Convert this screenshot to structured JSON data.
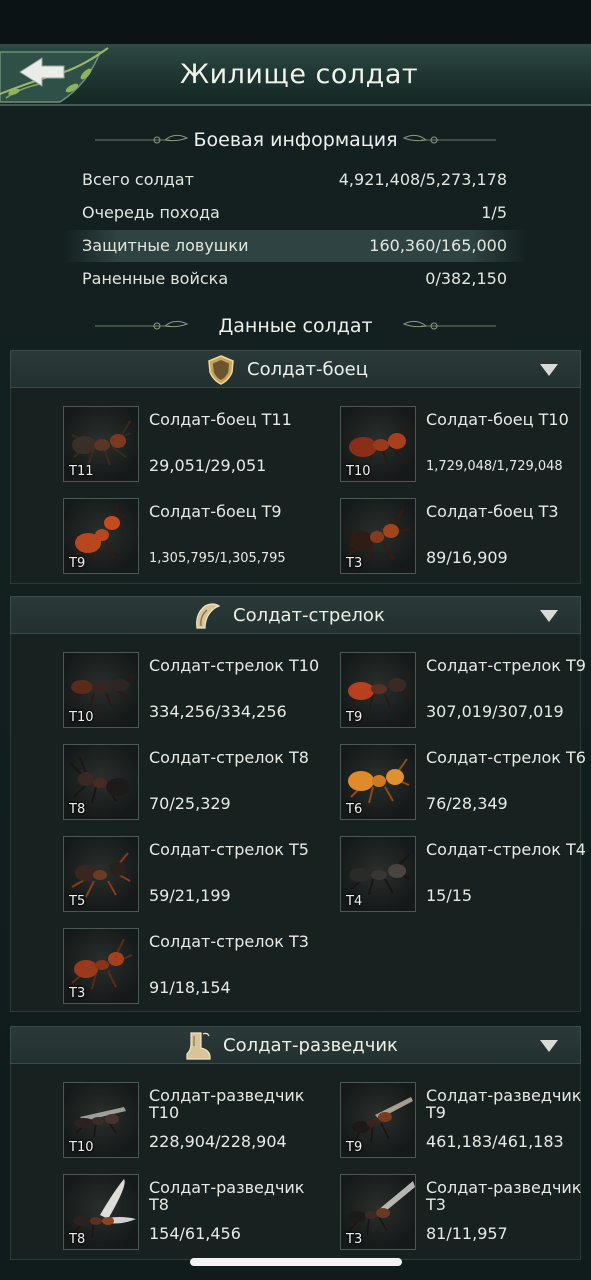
{
  "header": {
    "title": "Жилище солдат",
    "back_icon": "back-arrow-icon"
  },
  "battle_info": {
    "heading": "Боевая информация",
    "rows": [
      {
        "label": "Всего солдат",
        "value": "4,921,408/5,273,178"
      },
      {
        "label": "Очередь похода",
        "value": "1/5"
      },
      {
        "label": "Защитные ловушки",
        "value": "160,360/165,000"
      },
      {
        "label": "Раненные войска",
        "value": "0/382,150"
      }
    ]
  },
  "soldier_data": {
    "heading": "Данные солдат"
  },
  "categories": [
    {
      "name": "Солдат-боец",
      "icon": "shield-icon",
      "units": [
        {
          "name": "Солдат-боец T11",
          "count": "29,051/29,051",
          "tier": "T11"
        },
        {
          "name": "Солдат-боец T10",
          "count": "1,729,048/1,729,048",
          "tier": "T10"
        },
        {
          "name": "Солдат-боец T9",
          "count": "1,305,795/1,305,795",
          "tier": "T9"
        },
        {
          "name": "Солдат-боец T3",
          "count": "89/16,909",
          "tier": "T3"
        }
      ]
    },
    {
      "name": "Солдат-стрелок",
      "icon": "horn-icon",
      "units": [
        {
          "name": "Солдат-стрелок T10",
          "count": "334,256/334,256",
          "tier": "T10"
        },
        {
          "name": "Солдат-стрелок T9",
          "count": "307,019/307,019",
          "tier": "T9"
        },
        {
          "name": "Солдат-стрелок T8",
          "count": "70/25,329",
          "tier": "T8"
        },
        {
          "name": "Солдат-стрелок T6",
          "count": "76/28,349",
          "tier": "T6"
        },
        {
          "name": "Солдат-стрелок T5",
          "count": "59/21,199",
          "tier": "T5"
        },
        {
          "name": "Солдат-стрелок T4",
          "count": "15/15",
          "tier": "T4"
        },
        {
          "name": "Солдат-стрелок T3",
          "count": "91/18,154",
          "tier": "T3"
        }
      ]
    },
    {
      "name": "Солдат-разведчик",
      "icon": "boot-icon",
      "units": [
        {
          "name": "Солдат-разведчик T10",
          "count": "228,904/228,904",
          "tier": "T10"
        },
        {
          "name": "Солдат-разведчик T9",
          "count": "461,183/461,183",
          "tier": "T9"
        },
        {
          "name": "Солдат-разведчик T8",
          "count": "154/61,456",
          "tier": "T8"
        },
        {
          "name": "Солдат-разведчик T3",
          "count": "81/11,957",
          "tier": "T3"
        }
      ]
    }
  ],
  "colors": {
    "background": "#111c1d",
    "header": "#1e3531",
    "ant_red": "#b8461f",
    "ant_dark": "#2a1a14"
  }
}
